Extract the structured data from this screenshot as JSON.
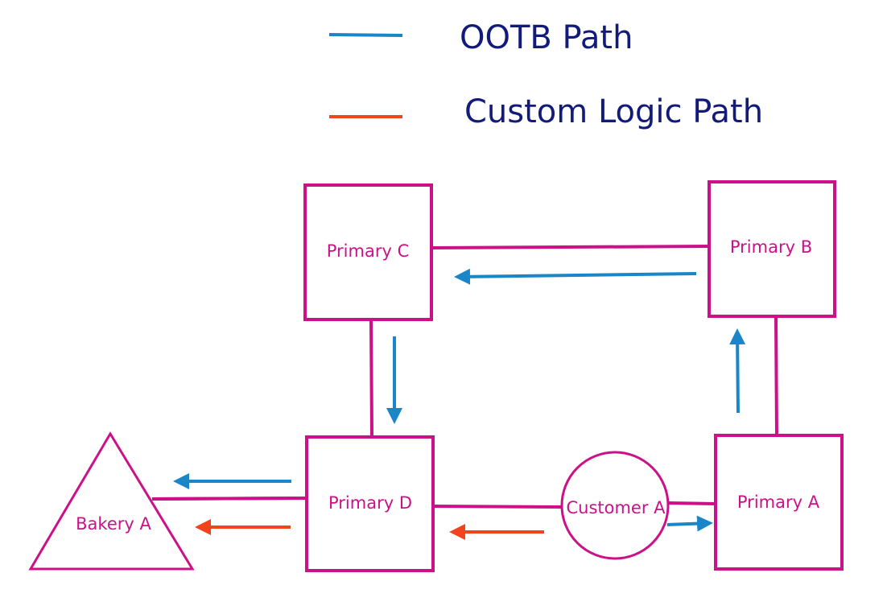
{
  "colors": {
    "node": "#cc1188",
    "ootb": "#1a86c8",
    "custom": "#f2421e",
    "legend_text": "#121a7a",
    "background": "#ffffff"
  },
  "legend": [
    {
      "key": "ootb",
      "label": "OOTB Path"
    },
    {
      "key": "custom",
      "label": "Custom Logic Path"
    }
  ],
  "nodes": [
    {
      "id": "primary-c",
      "label": "Primary C",
      "shape": "rect"
    },
    {
      "id": "primary-b",
      "label": "Primary B",
      "shape": "rect"
    },
    {
      "id": "primary-d",
      "label": "Primary D",
      "shape": "rect"
    },
    {
      "id": "primary-a",
      "label": "Primary A",
      "shape": "rect"
    },
    {
      "id": "customer-a",
      "label": "Customer A",
      "shape": "circle"
    },
    {
      "id": "bakery-a",
      "label": "Bakery A",
      "shape": "triangle"
    }
  ],
  "connections": [
    {
      "from": "primary-c",
      "to": "primary-b"
    },
    {
      "from": "primary-c",
      "to": "primary-d"
    },
    {
      "from": "primary-b",
      "to": "primary-a"
    },
    {
      "from": "primary-d",
      "to": "customer-a"
    },
    {
      "from": "customer-a",
      "to": "primary-a"
    },
    {
      "from": "primary-d",
      "to": "bakery-a"
    }
  ],
  "flows": [
    {
      "path": "ootb",
      "from": "primary-b",
      "to": "primary-c"
    },
    {
      "path": "ootb",
      "from": "primary-c",
      "to": "primary-d"
    },
    {
      "path": "ootb",
      "from": "primary-a",
      "to": "primary-b"
    },
    {
      "path": "ootb",
      "from": "customer-a",
      "to": "primary-a"
    },
    {
      "path": "ootb",
      "from": "primary-d",
      "to": "bakery-a"
    },
    {
      "path": "custom",
      "from": "customer-a",
      "to": "primary-d"
    },
    {
      "path": "custom",
      "from": "primary-d",
      "to": "bakery-a"
    }
  ]
}
